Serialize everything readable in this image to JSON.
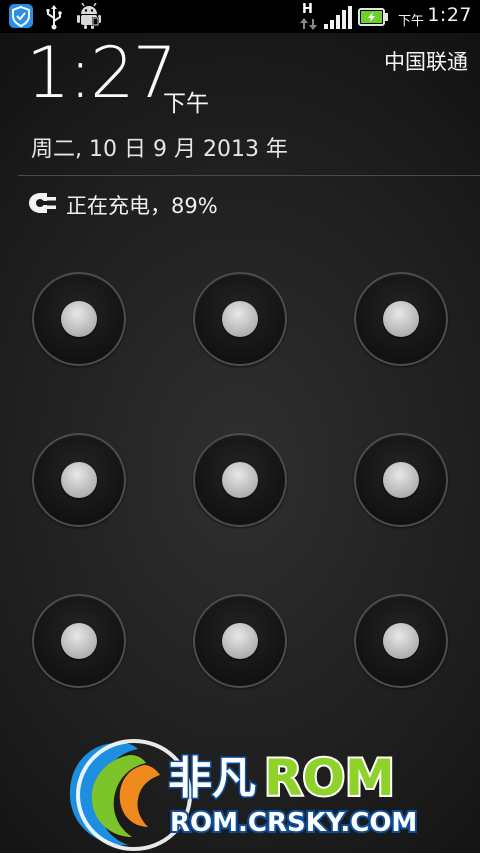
{
  "status_bar": {
    "network_type": "H",
    "ampm": "下午",
    "time": "1:27",
    "battery_state": "charging",
    "icons": [
      "shield-notification-icon",
      "usb-icon",
      "android-debug-icon",
      "network-type-icon",
      "signal-icon",
      "battery-charging-icon"
    ]
  },
  "lockscreen": {
    "clock": "1:27",
    "clock_ampm": "下午",
    "carrier": "中国联通",
    "date": "周二, 10 日 9 月 2013 年",
    "charging_text": "正在充电，89%",
    "charging_icon": "plug-icon"
  },
  "pattern_lock": {
    "rows": 3,
    "cols": 3,
    "dots": [
      {
        "id": 1
      },
      {
        "id": 2
      },
      {
        "id": 3
      },
      {
        "id": 4
      },
      {
        "id": 5
      },
      {
        "id": 6
      },
      {
        "id": 7
      },
      {
        "id": 8
      },
      {
        "id": 9
      }
    ]
  },
  "watermark": {
    "brand_cn": "非凡",
    "brand_en": "ROM",
    "url": "ROM.CRSKY.COM",
    "colors": {
      "blue": "#1e8fe0",
      "green": "#7dc32a",
      "orange": "#f08a1e"
    }
  },
  "colors": {
    "status_bar_bg": "#000000",
    "battery_fill": "#6cd12a",
    "text_primary": "#f5f5f5"
  }
}
